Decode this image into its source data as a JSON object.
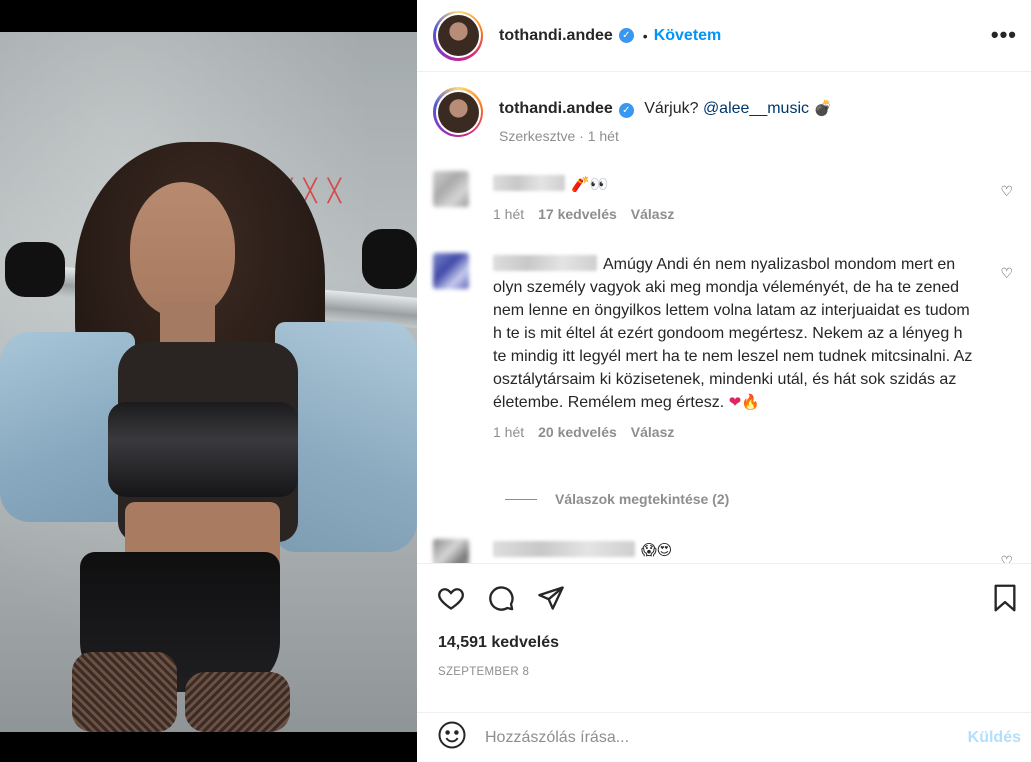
{
  "post": {
    "username": "tothandi.andee",
    "follow_label": "Követem",
    "dot": "•",
    "more_label": "•••",
    "verified_mark": "✓"
  },
  "caption": {
    "username": "tothandi.andee",
    "text": "Várjuk?",
    "mention": "@alee__music",
    "emoji": "💣",
    "edited": "Szerkesztve",
    "time": "1 hét"
  },
  "comments": [
    {
      "text": "",
      "emoji": "🧨👀",
      "time": "1 hét",
      "likes": "17 kedvelés",
      "reply": "Válasz"
    },
    {
      "text": "Amúgy Andi én nem nyalizasbol mondom mert en olyn személy vagyok aki meg mondja véleményét, de ha te zened nem lenne en öngyilkos lettem volna latam az interjuaidat es tudom h te is mit éltel át ezért gondoom megértesz. Nekem az a lényeg h te mindig itt legyél mert ha te nem leszel nem tudnek mitcsinalni. Az osztálytársaim ki közisetenek, mindenki utál, és hát sok szidás az életembe. Remélem meg értesz.",
      "emoji": "❤🔥",
      "time": "1 hét",
      "likes": "20 kedvelés",
      "reply": "Válasz",
      "view_replies": "Válaszok megtekintése (2)"
    },
    {
      "text": "",
      "emoji": "😱😍"
    }
  ],
  "actions": {
    "likes_total": "14,591 kedvelés",
    "date": "SZEPTEMBER 8"
  },
  "composer": {
    "placeholder": "Hozzászólás írása...",
    "send_label": "Küldés"
  }
}
